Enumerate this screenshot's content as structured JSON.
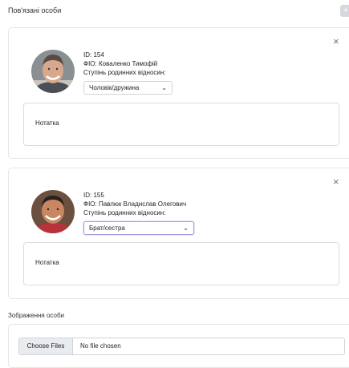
{
  "section": {
    "title": "Пов'язані особи",
    "add_icon": "+"
  },
  "persons": [
    {
      "id_line": "ID: 154",
      "name_line": "ФІО: Коваленко Тимофій",
      "relation_label": "Ступінь родинних відносин:",
      "relation_value": "Чоловік/дружина",
      "note_placeholder": "Нотатка",
      "close_icon": "×"
    },
    {
      "id_line": "ID: 155",
      "name_line": "ФІО: Павлюк Владислав Олегович",
      "relation_label": "Ступінь родинних відносин:",
      "relation_value": "Брат/сестра",
      "note_placeholder": "Нотатка",
      "close_icon": "×"
    }
  ],
  "image_section": {
    "label": "Зображення особи",
    "choose_button": "Choose Files",
    "status": "No file chosen"
  }
}
